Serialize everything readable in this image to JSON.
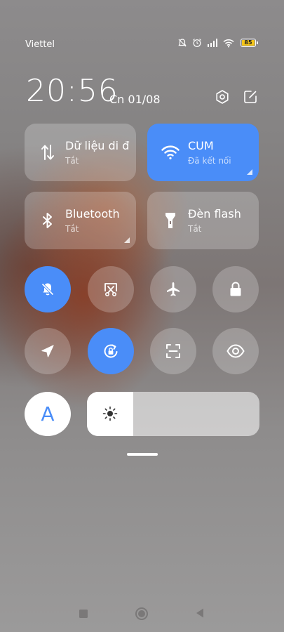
{
  "status_bar": {
    "carrier": "Viettel",
    "battery_level": "85",
    "icons": [
      "notifications-off-icon",
      "alarm-icon",
      "signal-icon",
      "wifi-icon",
      "battery-icon"
    ]
  },
  "header": {
    "time": "20:56",
    "date": "Cn 01/08",
    "icons": [
      "settings-icon",
      "edit-icon"
    ]
  },
  "tiles": [
    {
      "title": "Dữ liệu di động",
      "subtitle": "Tắt",
      "icon": "mobile-data-icon",
      "active": false
    },
    {
      "title": "CUM",
      "subtitle": "Đã kết nối",
      "icon": "wifi-icon",
      "active": true
    },
    {
      "title": "Bluetooth",
      "subtitle": "Tắt",
      "icon": "bluetooth-icon",
      "active": false
    },
    {
      "title": "Đèn flash",
      "subtitle": "Tắt",
      "icon": "flashlight-icon",
      "active": false
    }
  ],
  "toggles": [
    {
      "icon": "silent-mode-icon",
      "active": true
    },
    {
      "icon": "screenshot-icon",
      "active": false
    },
    {
      "icon": "airplane-mode-icon",
      "active": false
    },
    {
      "icon": "lock-screen-icon",
      "active": false
    },
    {
      "icon": "location-icon",
      "active": false
    },
    {
      "icon": "rotation-lock-icon",
      "active": true
    },
    {
      "icon": "scanner-icon",
      "active": false
    },
    {
      "icon": "reading-mode-icon",
      "active": false
    }
  ],
  "auto_brightness_label": "A",
  "brightness_level": 0.27,
  "colors": {
    "accent": "#4a8df8",
    "battery": "#f5c518"
  },
  "nav_bar": [
    "recents-icon",
    "home-icon",
    "back-icon"
  ]
}
